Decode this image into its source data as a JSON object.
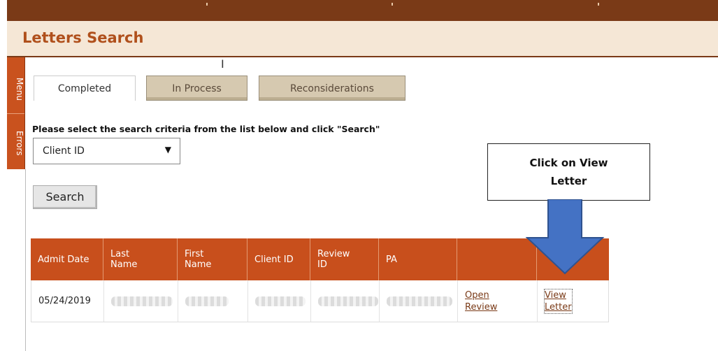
{
  "page": {
    "title": "Letters Search"
  },
  "sidebar": {
    "tabs": [
      "Menu",
      "Errors"
    ]
  },
  "tabs": [
    {
      "label": "Completed",
      "active": true
    },
    {
      "label": "In Process",
      "active": false
    },
    {
      "label": "Reconsiderations",
      "active": false
    }
  ],
  "search": {
    "instruction": "Please select the search criteria from the list below and click \"Search\"",
    "criteria_value": "Client ID",
    "button_label": "Search"
  },
  "callout": {
    "line1": "Click on View",
    "line2": "Letter"
  },
  "table": {
    "headers": [
      {
        "line1": "Admit Date",
        "line2": ""
      },
      {
        "line1": "Last",
        "line2": "Name"
      },
      {
        "line1": "First",
        "line2": "Name"
      },
      {
        "line1": "Client ID",
        "line2": ""
      },
      {
        "line1": "Review",
        "line2": "ID"
      },
      {
        "line1": "PA",
        "line2": ""
      },
      {
        "line1": "",
        "line2": ""
      },
      {
        "line1": "",
        "line2": ""
      }
    ],
    "rows": [
      {
        "admit_date": "05/24/2019",
        "open_review_1": "Open",
        "open_review_2": "Review",
        "view_letter_1": "View",
        "view_letter_2": "Letter"
      }
    ]
  },
  "colors": {
    "accent": "#c84f1c",
    "dark": "#7a3a17",
    "callout_arrow": "#4472c4"
  },
  "icons": {
    "dropdown": "caret-down-icon",
    "arrow": "down-arrow-icon"
  }
}
